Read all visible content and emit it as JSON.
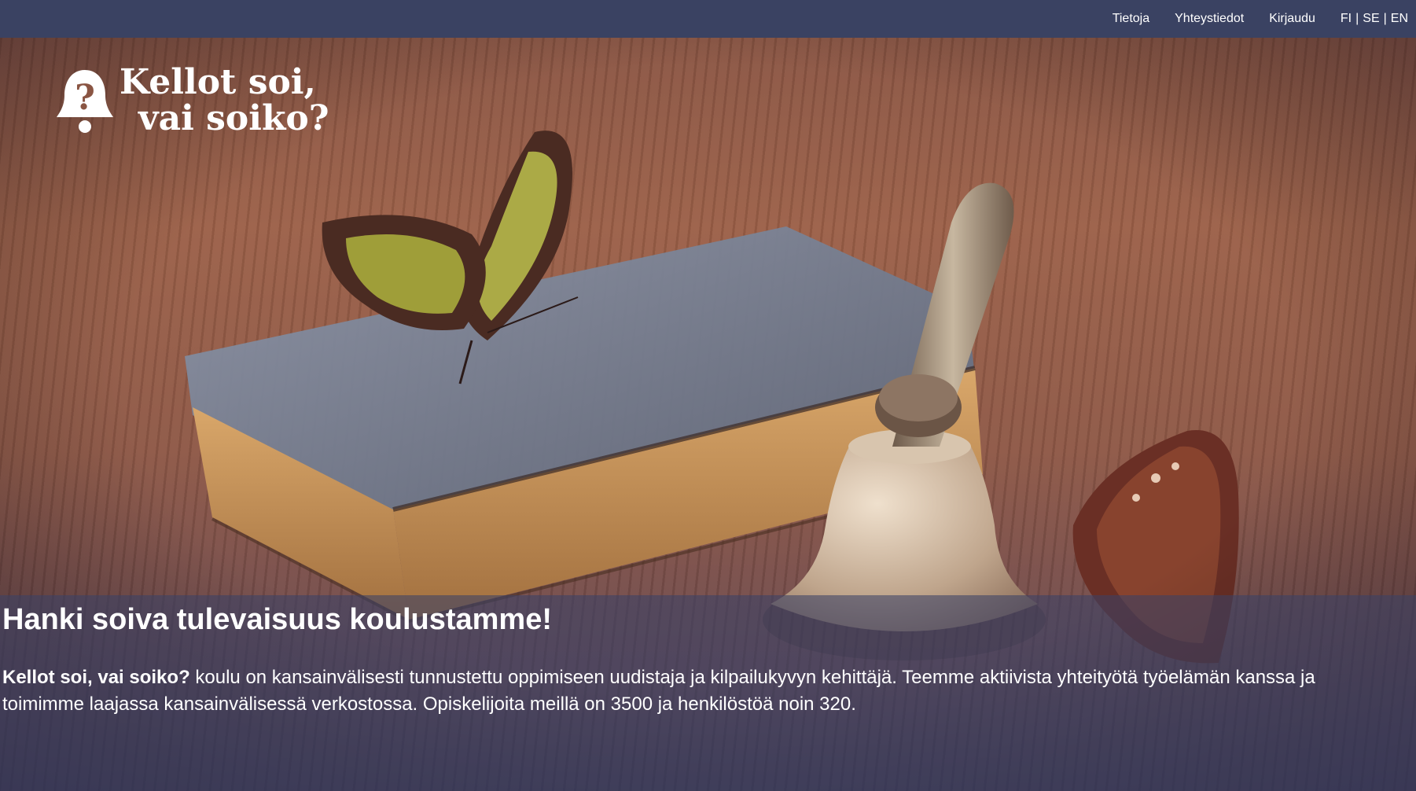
{
  "nav": {
    "items": [
      {
        "label": "Tietoja"
      },
      {
        "label": "Yhteystiedot"
      },
      {
        "label": "Kirjaudu"
      }
    ],
    "languages": [
      "FI",
      "SE",
      "EN"
    ],
    "separator": "|"
  },
  "logo": {
    "line1": "Kellot soi,",
    "line2": "vai soiko?",
    "icon": "bell-question-icon"
  },
  "hero": {
    "image": "book-bell-butterflies-photo"
  },
  "main": {
    "headline": "Hanki soiva tulevaisuus koulustamme!",
    "intro_strong": "Kellot soi, vai soiko?",
    "intro_rest": " koulu on kansainvälisesti tunnustettu oppimiseen uudistaja ja kilpailukyvyn kehittäjä. Teemme aktiivista yhteityötä työelämän kanssa ja toimimme laajassa kansainvälisessä verkostossa. Opiskelijoita meillä on 3500 ja henkilöstöä noin 320."
  },
  "colors": {
    "topbar": "#3a4262",
    "band": "#3a4266",
    "text": "#ffffff"
  }
}
